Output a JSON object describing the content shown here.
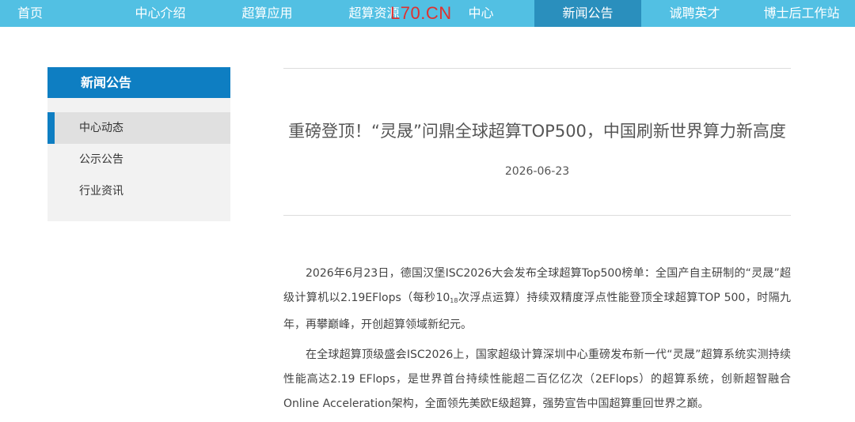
{
  "nav": {
    "items": [
      {
        "label": "首页"
      },
      {
        "label": "中心介绍"
      },
      {
        "label": "超算应用"
      },
      {
        "label": "超算资源"
      },
      {
        "label": "中心"
      },
      {
        "label": "新闻公告"
      },
      {
        "label": "诚聘英才"
      },
      {
        "label": "博士后工作站"
      }
    ],
    "active_index": 5
  },
  "watermark": "L70.CN",
  "sidebar": {
    "title": "新闻公告",
    "items": [
      {
        "label": "中心动态"
      },
      {
        "label": "公示公告"
      },
      {
        "label": "行业资讯"
      }
    ]
  },
  "article": {
    "title": "重磅登顶！“灵晟”问鼎全球超算TOP500，中国刷新世界算力新高度",
    "date": "2026-06-23",
    "para1_a": "2026年6月23日，德国汉堡ISC2026大会发布全球超算Top500榜单：全国产自主研制的“灵晟”超级计算机以2.19EFlops（每秒10",
    "para1_sup": "18",
    "para1_b": "次浮点运算）持续双精度浮点性能登顶全球超算TOP 500，时隔九年，再攀巅峰，开创超算领域新纪元。",
    "para2": "在全球超算顶级盛会ISC2026上，国家超级计算深圳中心重磅发布新一代“灵晟”超算系统实测持续性能高达2.19 EFlops，是世界首台持续性能超二百亿亿次（2EFlops）的超算系统，创新超智融合Online Acceleration架构，全面领先美欧E级超算，强势宣告中国超算重回世界之巅。"
  },
  "colors": {
    "nav_bg": "#52c0e3",
    "nav_active": "#2a8fbd",
    "sidebar_header": "#0e7ec2",
    "watermark": "#e0302f"
  }
}
